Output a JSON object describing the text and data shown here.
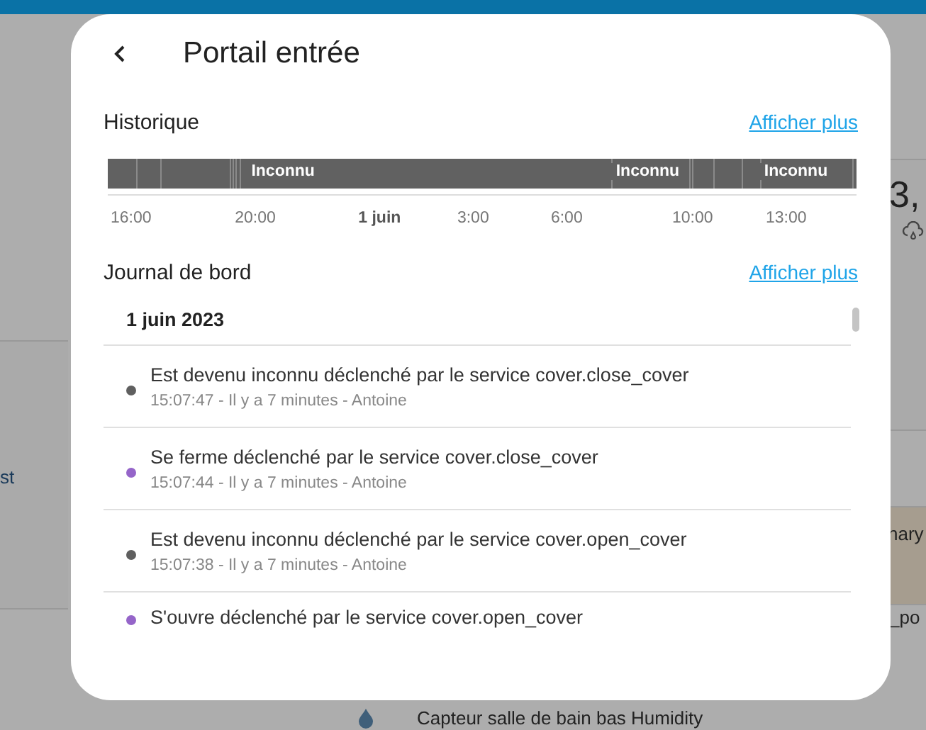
{
  "background": {
    "texts": [
      "st",
      "3,",
      "nary",
      "_po"
    ],
    "row": {
      "label": "Capteur salle de bain bas Humidity"
    }
  },
  "dialog": {
    "title": "Portail entrée",
    "history": {
      "heading": "Historique",
      "more_link": "Afficher plus",
      "segments": [
        {
          "label": "Inconnu"
        },
        {
          "label": "Inconnu"
        },
        {
          "label": "Inconnu"
        }
      ],
      "axis": [
        {
          "label": "16:00",
          "kind": "time"
        },
        {
          "label": "20:00",
          "kind": "time"
        },
        {
          "label": "1 juin",
          "kind": "date"
        },
        {
          "label": "3:00",
          "kind": "time"
        },
        {
          "label": "6:00",
          "kind": "time"
        },
        {
          "label": "10:00",
          "kind": "time"
        },
        {
          "label": "13:00",
          "kind": "time"
        }
      ]
    },
    "logbook": {
      "heading": "Journal de bord",
      "more_link": "Afficher plus",
      "date": "1 juin 2023",
      "entries": [
        {
          "message": "Est devenu inconnu déclenché par le service cover.close_cover",
          "details": "15:07:47 - Il y a 7 minutes - Antoine",
          "color": "#5f5f5f"
        },
        {
          "message": "Se ferme déclenché par le service cover.close_cover",
          "details": "15:07:44 - Il y a 7 minutes - Antoine",
          "color": "#9565c9"
        },
        {
          "message": "Est devenu inconnu déclenché par le service cover.open_cover",
          "details": "15:07:38 - Il y a 7 minutes - Antoine",
          "color": "#5f5f5f"
        },
        {
          "message": "S'ouvre déclenché par le service cover.open_cover",
          "color": "#9565c9"
        }
      ]
    }
  }
}
